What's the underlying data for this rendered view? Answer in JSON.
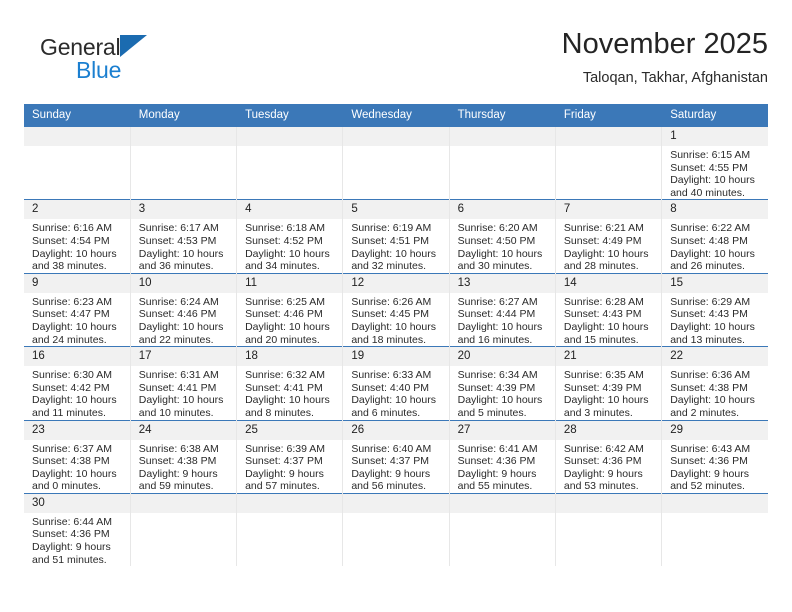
{
  "brand": {
    "name_part1": "General",
    "name_part2": "Blue",
    "triangle_color": "#1b6bb0",
    "blue_color": "#1b7fd0"
  },
  "header": {
    "title": "November 2025",
    "subtitle": "Taloqan, Takhar, Afghanistan"
  },
  "theme": {
    "header_blue": "#3b78b8",
    "daynum_bg": "#f1f1f1",
    "grid_line": "#e7e7e7"
  },
  "calendar": {
    "weekday_headers": [
      "Sunday",
      "Monday",
      "Tuesday",
      "Wednesday",
      "Thursday",
      "Friday",
      "Saturday"
    ],
    "labels": {
      "sunrise": "Sunrise:",
      "sunset": "Sunset:",
      "daylight": "Daylight:"
    },
    "weeks": [
      [
        {
          "blank": true,
          "day": ""
        },
        {
          "blank": true,
          "day": ""
        },
        {
          "blank": true,
          "day": ""
        },
        {
          "blank": true,
          "day": ""
        },
        {
          "blank": true,
          "day": ""
        },
        {
          "blank": true,
          "day": ""
        },
        {
          "blank": false,
          "day": "1",
          "sunrise": "Sunrise: 6:15 AM",
          "sunset": "Sunset: 4:55 PM",
          "daylight_line1": "Daylight: 10 hours",
          "daylight_line2": "and 40 minutes."
        }
      ],
      [
        {
          "blank": false,
          "day": "2",
          "sunrise": "Sunrise: 6:16 AM",
          "sunset": "Sunset: 4:54 PM",
          "daylight_line1": "Daylight: 10 hours",
          "daylight_line2": "and 38 minutes."
        },
        {
          "blank": false,
          "day": "3",
          "sunrise": "Sunrise: 6:17 AM",
          "sunset": "Sunset: 4:53 PM",
          "daylight_line1": "Daylight: 10 hours",
          "daylight_line2": "and 36 minutes."
        },
        {
          "blank": false,
          "day": "4",
          "sunrise": "Sunrise: 6:18 AM",
          "sunset": "Sunset: 4:52 PM",
          "daylight_line1": "Daylight: 10 hours",
          "daylight_line2": "and 34 minutes."
        },
        {
          "blank": false,
          "day": "5",
          "sunrise": "Sunrise: 6:19 AM",
          "sunset": "Sunset: 4:51 PM",
          "daylight_line1": "Daylight: 10 hours",
          "daylight_line2": "and 32 minutes."
        },
        {
          "blank": false,
          "day": "6",
          "sunrise": "Sunrise: 6:20 AM",
          "sunset": "Sunset: 4:50 PM",
          "daylight_line1": "Daylight: 10 hours",
          "daylight_line2": "and 30 minutes."
        },
        {
          "blank": false,
          "day": "7",
          "sunrise": "Sunrise: 6:21 AM",
          "sunset": "Sunset: 4:49 PM",
          "daylight_line1": "Daylight: 10 hours",
          "daylight_line2": "and 28 minutes."
        },
        {
          "blank": false,
          "day": "8",
          "sunrise": "Sunrise: 6:22 AM",
          "sunset": "Sunset: 4:48 PM",
          "daylight_line1": "Daylight: 10 hours",
          "daylight_line2": "and 26 minutes."
        }
      ],
      [
        {
          "blank": false,
          "day": "9",
          "sunrise": "Sunrise: 6:23 AM",
          "sunset": "Sunset: 4:47 PM",
          "daylight_line1": "Daylight: 10 hours",
          "daylight_line2": "and 24 minutes."
        },
        {
          "blank": false,
          "day": "10",
          "sunrise": "Sunrise: 6:24 AM",
          "sunset": "Sunset: 4:46 PM",
          "daylight_line1": "Daylight: 10 hours",
          "daylight_line2": "and 22 minutes."
        },
        {
          "blank": false,
          "day": "11",
          "sunrise": "Sunrise: 6:25 AM",
          "sunset": "Sunset: 4:46 PM",
          "daylight_line1": "Daylight: 10 hours",
          "daylight_line2": "and 20 minutes."
        },
        {
          "blank": false,
          "day": "12",
          "sunrise": "Sunrise: 6:26 AM",
          "sunset": "Sunset: 4:45 PM",
          "daylight_line1": "Daylight: 10 hours",
          "daylight_line2": "and 18 minutes."
        },
        {
          "blank": false,
          "day": "13",
          "sunrise": "Sunrise: 6:27 AM",
          "sunset": "Sunset: 4:44 PM",
          "daylight_line1": "Daylight: 10 hours",
          "daylight_line2": "and 16 minutes."
        },
        {
          "blank": false,
          "day": "14",
          "sunrise": "Sunrise: 6:28 AM",
          "sunset": "Sunset: 4:43 PM",
          "daylight_line1": "Daylight: 10 hours",
          "daylight_line2": "and 15 minutes."
        },
        {
          "blank": false,
          "day": "15",
          "sunrise": "Sunrise: 6:29 AM",
          "sunset": "Sunset: 4:43 PM",
          "daylight_line1": "Daylight: 10 hours",
          "daylight_line2": "and 13 minutes."
        }
      ],
      [
        {
          "blank": false,
          "day": "16",
          "sunrise": "Sunrise: 6:30 AM",
          "sunset": "Sunset: 4:42 PM",
          "daylight_line1": "Daylight: 10 hours",
          "daylight_line2": "and 11 minutes."
        },
        {
          "blank": false,
          "day": "17",
          "sunrise": "Sunrise: 6:31 AM",
          "sunset": "Sunset: 4:41 PM",
          "daylight_line1": "Daylight: 10 hours",
          "daylight_line2": "and 10 minutes."
        },
        {
          "blank": false,
          "day": "18",
          "sunrise": "Sunrise: 6:32 AM",
          "sunset": "Sunset: 4:41 PM",
          "daylight_line1": "Daylight: 10 hours",
          "daylight_line2": "and 8 minutes."
        },
        {
          "blank": false,
          "day": "19",
          "sunrise": "Sunrise: 6:33 AM",
          "sunset": "Sunset: 4:40 PM",
          "daylight_line1": "Daylight: 10 hours",
          "daylight_line2": "and 6 minutes."
        },
        {
          "blank": false,
          "day": "20",
          "sunrise": "Sunrise: 6:34 AM",
          "sunset": "Sunset: 4:39 PM",
          "daylight_line1": "Daylight: 10 hours",
          "daylight_line2": "and 5 minutes."
        },
        {
          "blank": false,
          "day": "21",
          "sunrise": "Sunrise: 6:35 AM",
          "sunset": "Sunset: 4:39 PM",
          "daylight_line1": "Daylight: 10 hours",
          "daylight_line2": "and 3 minutes."
        },
        {
          "blank": false,
          "day": "22",
          "sunrise": "Sunrise: 6:36 AM",
          "sunset": "Sunset: 4:38 PM",
          "daylight_line1": "Daylight: 10 hours",
          "daylight_line2": "and 2 minutes."
        }
      ],
      [
        {
          "blank": false,
          "day": "23",
          "sunrise": "Sunrise: 6:37 AM",
          "sunset": "Sunset: 4:38 PM",
          "daylight_line1": "Daylight: 10 hours",
          "daylight_line2": "and 0 minutes."
        },
        {
          "blank": false,
          "day": "24",
          "sunrise": "Sunrise: 6:38 AM",
          "sunset": "Sunset: 4:38 PM",
          "daylight_line1": "Daylight: 9 hours",
          "daylight_line2": "and 59 minutes."
        },
        {
          "blank": false,
          "day": "25",
          "sunrise": "Sunrise: 6:39 AM",
          "sunset": "Sunset: 4:37 PM",
          "daylight_line1": "Daylight: 9 hours",
          "daylight_line2": "and 57 minutes."
        },
        {
          "blank": false,
          "day": "26",
          "sunrise": "Sunrise: 6:40 AM",
          "sunset": "Sunset: 4:37 PM",
          "daylight_line1": "Daylight: 9 hours",
          "daylight_line2": "and 56 minutes."
        },
        {
          "blank": false,
          "day": "27",
          "sunrise": "Sunrise: 6:41 AM",
          "sunset": "Sunset: 4:36 PM",
          "daylight_line1": "Daylight: 9 hours",
          "daylight_line2": "and 55 minutes."
        },
        {
          "blank": false,
          "day": "28",
          "sunrise": "Sunrise: 6:42 AM",
          "sunset": "Sunset: 4:36 PM",
          "daylight_line1": "Daylight: 9 hours",
          "daylight_line2": "and 53 minutes."
        },
        {
          "blank": false,
          "day": "29",
          "sunrise": "Sunrise: 6:43 AM",
          "sunset": "Sunset: 4:36 PM",
          "daylight_line1": "Daylight: 9 hours",
          "daylight_line2": "and 52 minutes."
        }
      ],
      [
        {
          "blank": false,
          "day": "30",
          "sunrise": "Sunrise: 6:44 AM",
          "sunset": "Sunset: 4:36 PM",
          "daylight_line1": "Daylight: 9 hours",
          "daylight_line2": "and 51 minutes."
        },
        {
          "blank": true,
          "day": ""
        },
        {
          "blank": true,
          "day": ""
        },
        {
          "blank": true,
          "day": ""
        },
        {
          "blank": true,
          "day": ""
        },
        {
          "blank": true,
          "day": ""
        },
        {
          "blank": true,
          "day": ""
        }
      ]
    ]
  }
}
